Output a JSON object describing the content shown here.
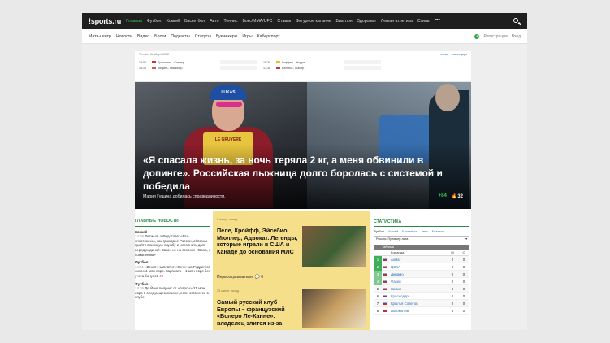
{
  "site": {
    "logo": "sports.ru",
    "logo_bang": "!",
    "nav": [
      "Главная",
      "Футбол",
      "Хоккей",
      "Баскетбол",
      "Авто",
      "Теннис",
      "Бокс/MMA/UFC",
      "Ставки",
      "Фигурное катание",
      "Биатлон",
      "Здоровье",
      "Легкая атлетика",
      "Стиль"
    ],
    "nav_more": "•••",
    "subnav": [
      "Матч-центр",
      "Новости",
      "Видео",
      "Блоги",
      "Подкасты",
      "Статусы",
      "Букмекеры",
      "Игры",
      "Киберспорт"
    ],
    "register": "Регистрация",
    "login": "Вход",
    "register_icon": "+"
  },
  "scores": {
    "header": "Теннис. Кемберс 2022",
    "links": [
      "сетка",
      "календарь"
    ],
    "rows": [
      {
        "left": {
          "time": "15:00",
          "teams": "Джокович – Синнер"
        },
        "right": {
          "time": "16:30",
          "teams": "Гоффен – Норри"
        }
      },
      {
        "left": {
          "time": "15:10",
          "teams": "Медин – Нишибер"
        },
        "right": {
          "time": "17:30",
          "teams": "Белянк – Жабер"
        }
      }
    ]
  },
  "hero": {
    "headline": "«Я спасала жизнь, за ночь теряла 2 кг, а меня обвинили в допинге». Российская лыжница долго боролась с системой и победила",
    "subtitle": "Мария Гущина добилась справедливости.",
    "rating": "+84",
    "likes": "32",
    "bib_text": "LE GRUYERE",
    "helmet_text": "LUKAS"
  },
  "news": {
    "title": "ГЛАВНЫЕ НОВОСТИ",
    "items": [
      {
        "cat": "Хоккей",
        "time": "14:59",
        "text": "Фетисов о Федотове: «Все спортсмены, как граждане России, обязаны пройти воинскую службу и исполнить долг перед родиной. Закон не на стороне Ивана, к сожалению»",
        "count": ""
      },
      {
        "cat": "Футбол",
        "time": "14:51",
        "text": "«Зенит» заплатит «Сочи» за Родригеса около 4 млн евро. Зарплата – 1 млн евро без учета бонусов",
        "count": "49"
      },
      {
        "cat": "Футбол",
        "time": "14:36",
        "text": "Де Йонг получит от «Барсы» 21 млн евро в следующем сезоне, если останется в клубе",
        "count": ""
      }
    ]
  },
  "featured": [
    {
      "time": "8 минут назад",
      "title": "Пеле, Кройфф, Эйсебио, Мюллер, Адвокат. Легенды, которые играли в США и Канаде до основания МЛС",
      "comments": "Первоотркыватели!",
      "comments_icon": "💬",
      "count": "6"
    },
    {
      "time": "35 минут назад",
      "title": "Самый русский клуб Европы – французский «Волеро Ле-Канне»: владелец злится из-за"
    }
  ],
  "stats": {
    "title": "СТАТИСТИКА",
    "tabs": [
      "Футбол",
      "Хоккей",
      "Баскетбол",
      "Авто",
      "Биатлон"
    ],
    "select": "Россия. Премьер-лига",
    "table_label": "Таблица",
    "cols": [
      "Команда",
      "М",
      "О"
    ],
    "rows": [
      {
        "pos": "1",
        "name": "Ахмат",
        "m": "0",
        "o": "0",
        "color": "#3fae5a"
      },
      {
        "pos": "2",
        "name": "ЦСКА",
        "m": "0",
        "o": "0",
        "color": "#3fae5a"
      },
      {
        "pos": "3",
        "name": "Динамо",
        "m": "0",
        "o": "0",
        "color": "#7fc98e"
      },
      {
        "pos": "4",
        "name": "Факел",
        "m": "0",
        "o": "0",
        "color": "#7fc98e"
      },
      {
        "pos": "5",
        "name": "Химки",
        "m": "0",
        "o": "0",
        "color": ""
      },
      {
        "pos": "6",
        "name": "Краснодар",
        "m": "0",
        "o": "0",
        "color": ""
      },
      {
        "pos": "7",
        "name": "Крылья Советов",
        "m": "0",
        "o": "0",
        "color": ""
      },
      {
        "pos": "8",
        "name": "Локомотив",
        "m": "0",
        "o": "0",
        "color": ""
      }
    ]
  }
}
